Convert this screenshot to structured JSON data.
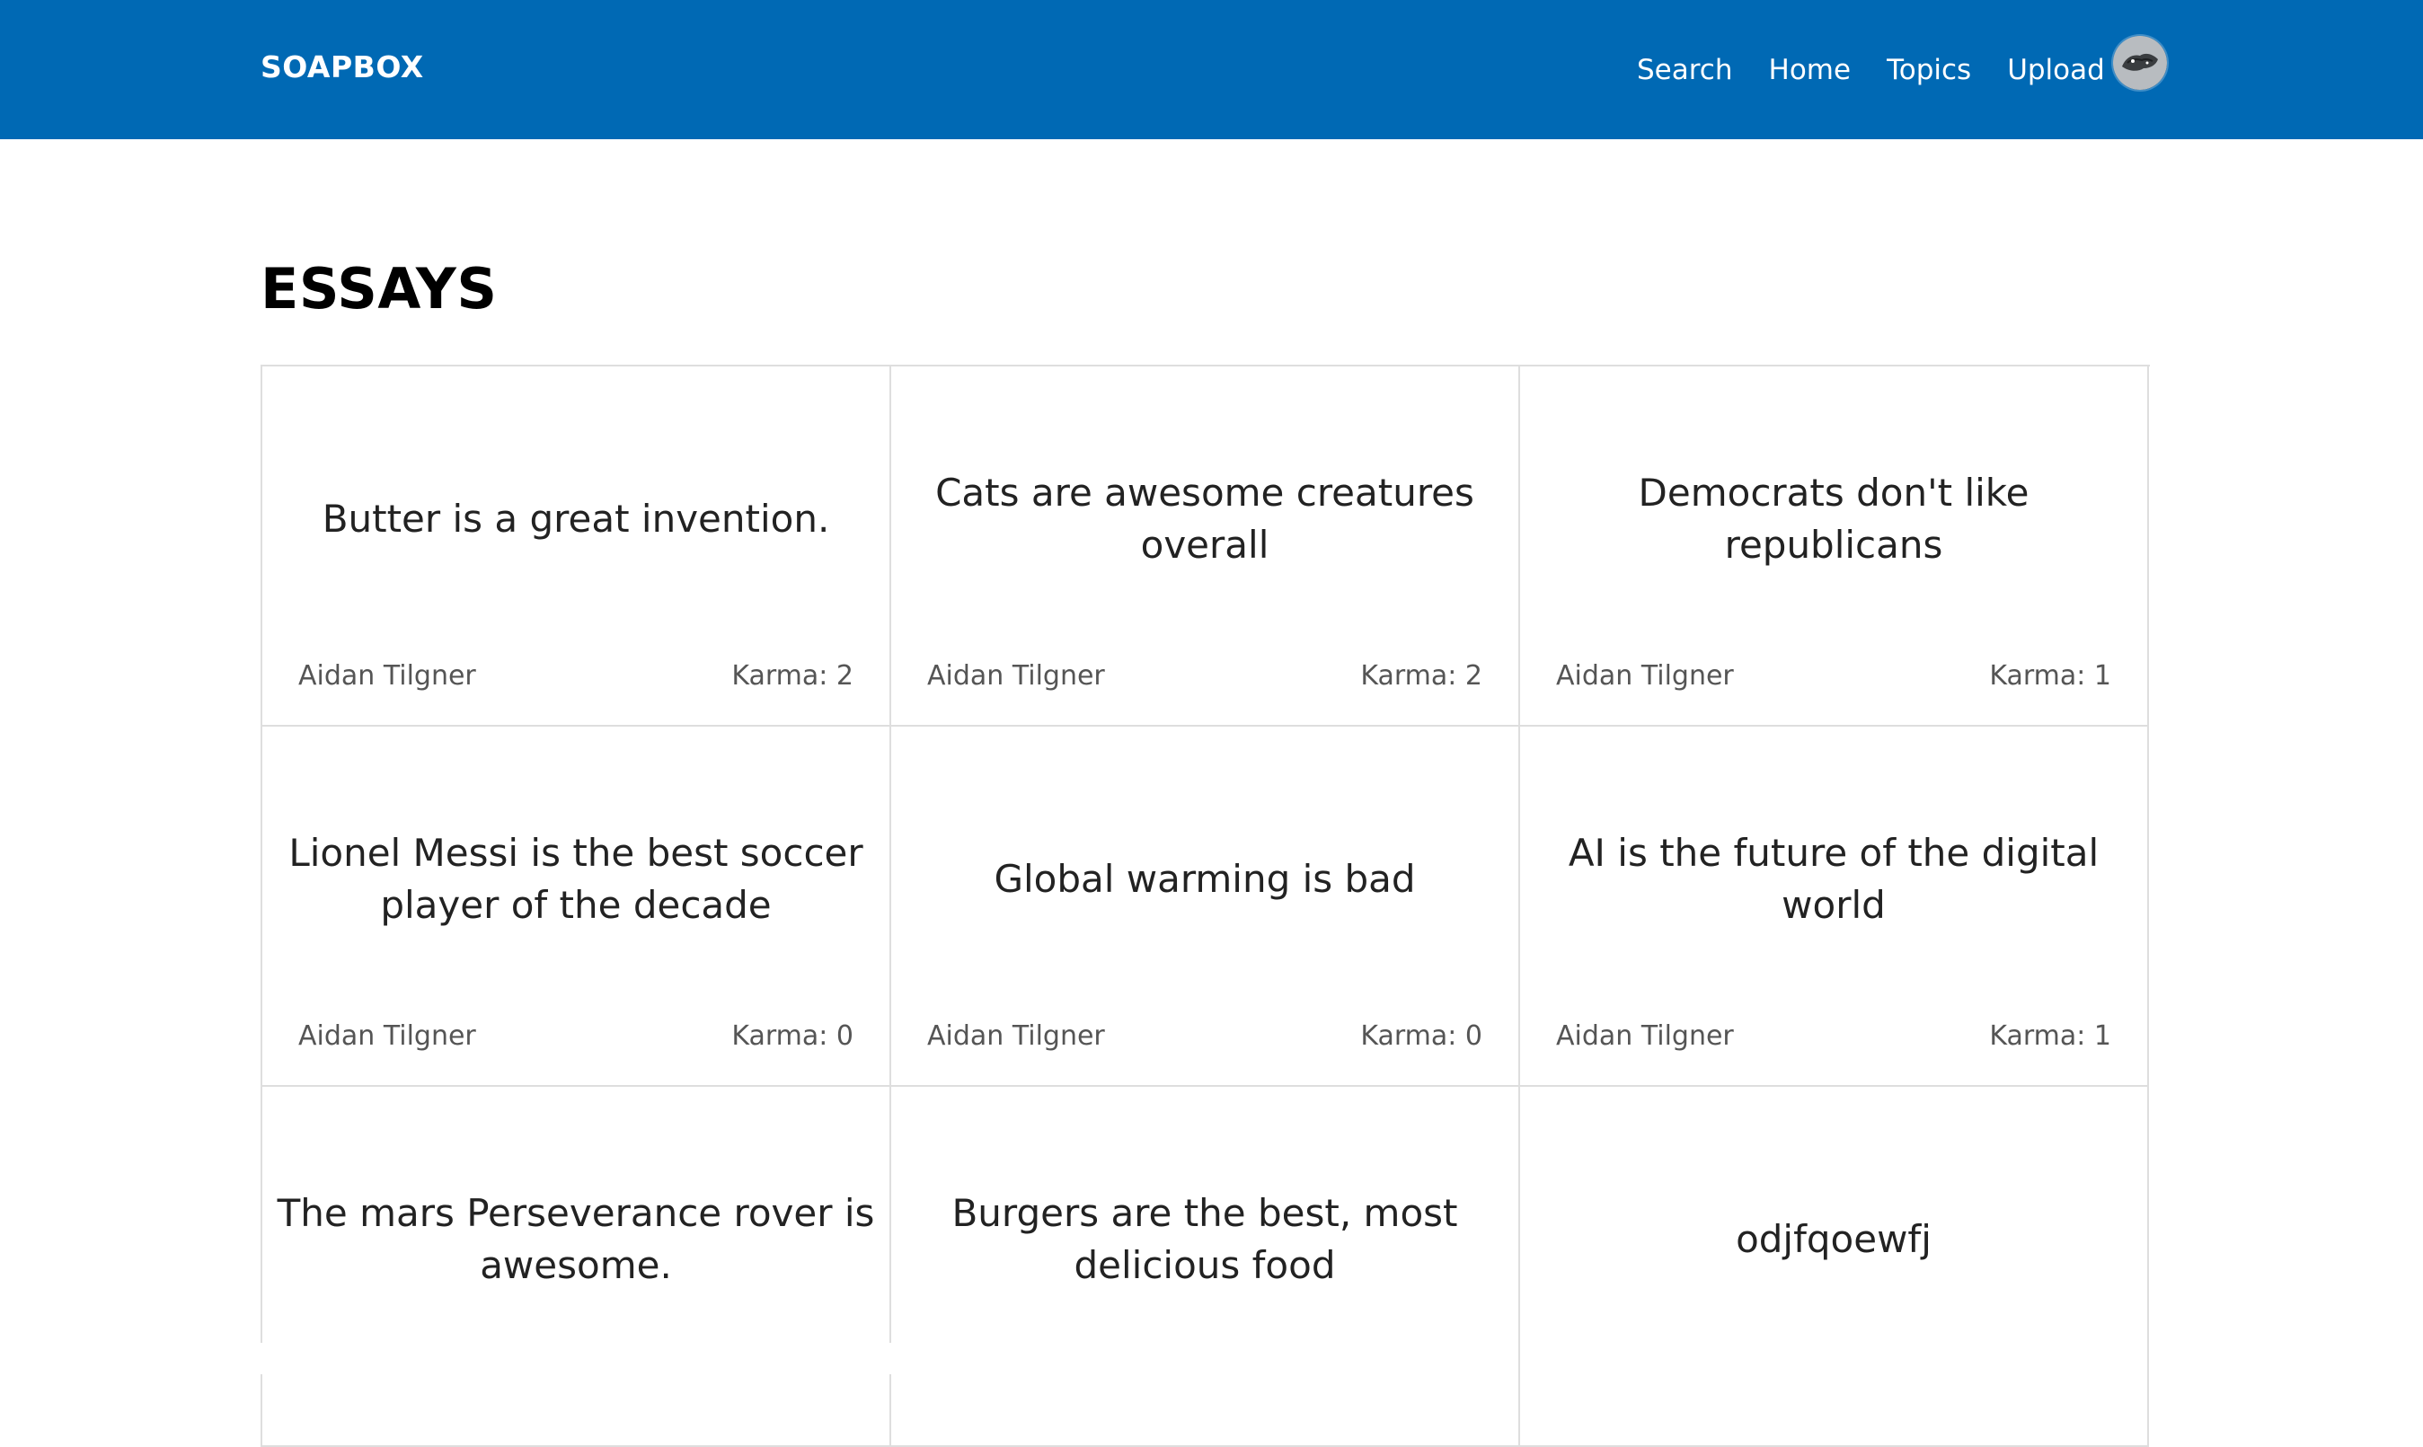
{
  "header": {
    "brand": "SOAPBOX",
    "nav": [
      {
        "label": "Search"
      },
      {
        "label": "Home"
      },
      {
        "label": "Topics"
      },
      {
        "label": "Upload"
      }
    ],
    "avatar_icon": "user-avatar"
  },
  "main": {
    "title": "ESSAYS",
    "essays": [
      {
        "title": "Butter is a great invention.",
        "author": "Aidan Tilgner",
        "karma": "Karma: 2"
      },
      {
        "title": "Cats are awesome creatures overall",
        "author": "Aidan Tilgner",
        "karma": "Karma: 2"
      },
      {
        "title": "Democrats don't like republicans",
        "author": "Aidan Tilgner",
        "karma": "Karma: 1"
      },
      {
        "title": "Lionel Messi is the best soccer player of the decade",
        "author": "Aidan Tilgner",
        "karma": "Karma: 0"
      },
      {
        "title": "Global warming is bad",
        "author": "Aidan Tilgner",
        "karma": "Karma: 0"
      },
      {
        "title": "AI is the future of the digital world",
        "author": "Aidan Tilgner",
        "karma": "Karma: 1"
      },
      {
        "title": "The mars Perseverance rover is awesome.",
        "author": "",
        "karma": ""
      },
      {
        "title": "Burgers are the best, most delicious food",
        "author": "",
        "karma": ""
      },
      {
        "title": "odjfqoewfj",
        "author": "",
        "karma": ""
      }
    ]
  },
  "colors": {
    "navbar": "#0069b4",
    "border": "#dedede",
    "text": "#222222",
    "meta": "#555555"
  }
}
